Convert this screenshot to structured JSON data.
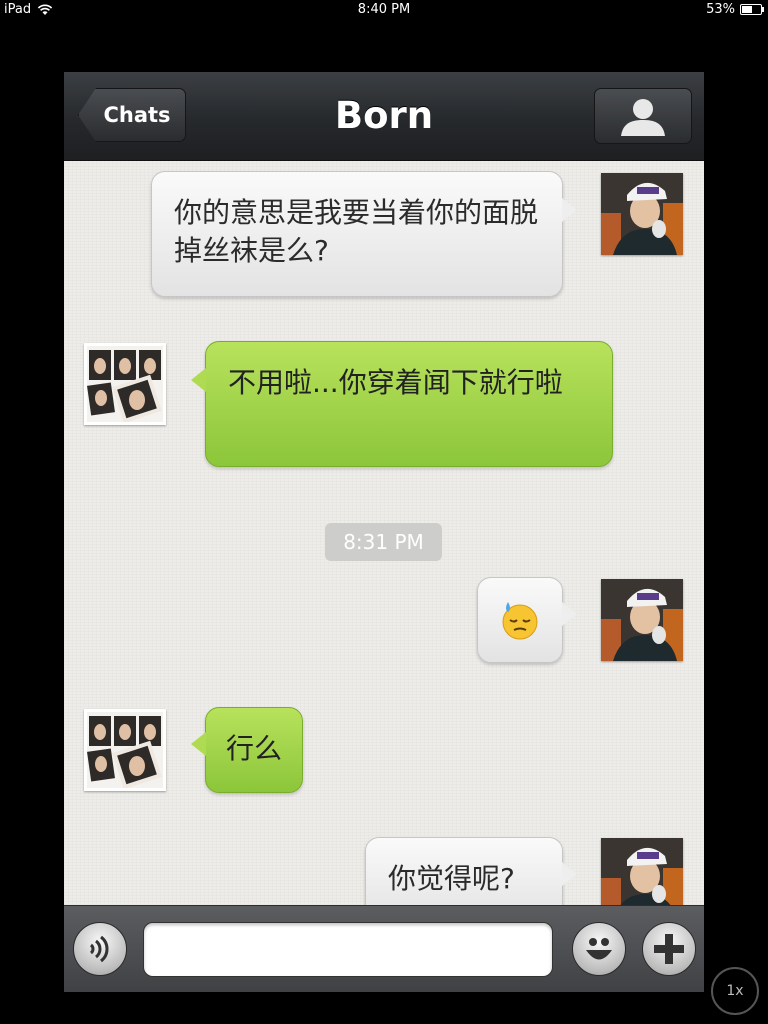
{
  "status_bar": {
    "device": "iPad",
    "time": "8:40 PM",
    "battery": "53%",
    "battery_level": 0.53
  },
  "nav": {
    "back_label": "Chats",
    "title": "Born"
  },
  "messages": [
    {
      "sender": "me",
      "type": "text",
      "text": "你的意思是我要当着你的面脱掉丝袜是么?"
    },
    {
      "sender": "them",
      "type": "text",
      "text": "不用啦...你穿着闻下就行啦"
    },
    {
      "sender": "system",
      "type": "timestamp",
      "text": "8:31 PM"
    },
    {
      "sender": "me",
      "type": "emoji",
      "icon": "sweat-emoji-icon"
    },
    {
      "sender": "them",
      "type": "text",
      "text": "行么"
    },
    {
      "sender": "me",
      "type": "text",
      "text": "你觉得呢?"
    }
  ],
  "input": {
    "value": "",
    "placeholder": ""
  },
  "zoom": "1x",
  "colors": {
    "bubble_green": "#9ed047",
    "bubble_white": "#f0f0f0",
    "navbar": "#26292c",
    "chat_bg": "#edece8"
  }
}
